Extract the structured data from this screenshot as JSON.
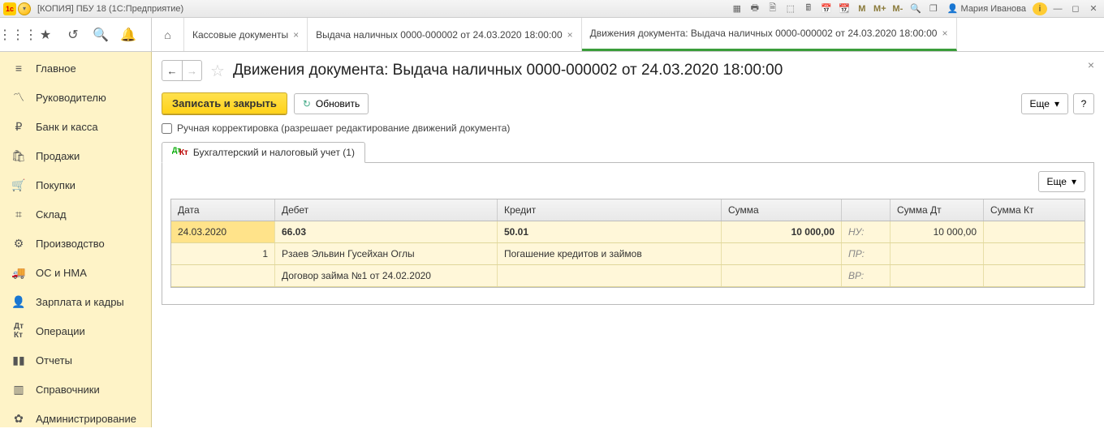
{
  "titlebar": {
    "title": "[КОПИЯ] ПБУ 18 (1С:Предприятие)",
    "m1": "M",
    "m2": "M+",
    "m3": "M-",
    "user": "Мария Иванова"
  },
  "doc_tabs": [
    {
      "label": "Кассовые документы"
    },
    {
      "label": "Выдача наличных 0000-000002 от 24.03.2020 18:00:00"
    },
    {
      "label": "Движения документа: Выдача наличных 0000-000002 от 24.03.2020 18:00:00",
      "active": true
    }
  ],
  "sidebar": {
    "items": [
      {
        "label": "Главное",
        "icon": "≡"
      },
      {
        "label": "Руководителю",
        "icon": "📈"
      },
      {
        "label": "Банк и касса",
        "icon": "₽"
      },
      {
        "label": "Продажи",
        "icon": "🛍"
      },
      {
        "label": "Покупки",
        "icon": "🛒"
      },
      {
        "label": "Склад",
        "icon": "🏢"
      },
      {
        "label": "Производство",
        "icon": "🏭"
      },
      {
        "label": "ОС и НМА",
        "icon": "🚚"
      },
      {
        "label": "Зарплата и кадры",
        "icon": "👤"
      },
      {
        "label": "Операции",
        "icon": "ᴬᵀ"
      },
      {
        "label": "Отчеты",
        "icon": "📊"
      },
      {
        "label": "Справочники",
        "icon": "📚"
      },
      {
        "label": "Администрирование",
        "icon": "⚙"
      }
    ]
  },
  "page": {
    "title": "Движения документа: Выдача наличных 0000-000002 от 24.03.2020 18:00:00",
    "btn_save": "Записать и закрыть",
    "btn_refresh": "Обновить",
    "btn_more": "Еще",
    "checkbox_label": "Ручная корректировка (разрешает редактирование движений документа)",
    "sub_tab": "Бухгалтерский и налоговый учет (1)"
  },
  "grid": {
    "head": {
      "date": "Дата",
      "debet": "Дебет",
      "kredit": "Кредит",
      "sum": "Сумма",
      "sumdt": "Сумма Дт",
      "sumkt": "Сумма Кт"
    },
    "row1": {
      "date": "24.03.2020",
      "debet": "66.03",
      "kredit": "50.01",
      "sum": "10 000,00",
      "nr": "НУ:",
      "sumdt": "10 000,00"
    },
    "row2": {
      "n": "1",
      "debet": "Рзаев Эльвин Гусейхан Оглы",
      "kredit": "Погашение кредитов и займов",
      "nr": "ПР:"
    },
    "row3": {
      "debet": "Договор займа №1 от 24.02.2020",
      "nr": "ВР:"
    }
  }
}
